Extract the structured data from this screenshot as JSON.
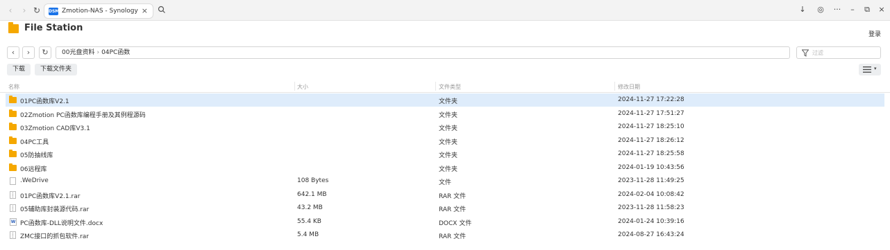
{
  "browser": {
    "tab_title": "Zmotion-NAS - Synology N",
    "favicon_text": "DSM"
  },
  "app": {
    "title": "File Station",
    "login": "登录"
  },
  "path": {
    "parts": [
      "00光盘资料",
      "04PC函数"
    ]
  },
  "filter": {
    "placeholder": "过滤"
  },
  "actions": {
    "download": "下载",
    "download_folder": "下载文件夹"
  },
  "columns": {
    "name": "名称",
    "size": "大小",
    "type": "文件类型",
    "modified": "修改日期"
  },
  "files": [
    {
      "name": "01PC函数库V2.1",
      "size": "",
      "type": "文件夹",
      "modified": "2024-11-27 17:22:28",
      "icon": "folder-icon"
    },
    {
      "name": "02Zmotion PC函数库编程手册及其例程源码",
      "size": "",
      "type": "文件夹",
      "modified": "2024-11-27 17:51:27",
      "icon": "folder-icon"
    },
    {
      "name": "03Zmotion CAD库V3.1",
      "size": "",
      "type": "文件夹",
      "modified": "2024-11-27 18:25:10",
      "icon": "folder-icon"
    },
    {
      "name": "04PC工具",
      "size": "",
      "type": "文件夹",
      "modified": "2024-11-27 18:26:12",
      "icon": "folder-icon"
    },
    {
      "name": "05防抽线库",
      "size": "",
      "type": "文件夹",
      "modified": "2024-11-27 18:25:58",
      "icon": "folder-icon"
    },
    {
      "name": "06远程库",
      "size": "",
      "type": "文件夹",
      "modified": "2024-01-19 10:43:56",
      "icon": "folder-icon"
    },
    {
      "name": ".WeDrive",
      "size": "108 Bytes",
      "type": "文件",
      "modified": "2023-11-28 11:49:25",
      "icon": "file-icon"
    },
    {
      "name": "01PC函数库V2.1.rar",
      "size": "642.1 MB",
      "type": "RAR 文件",
      "modified": "2024-02-04 10:08:42",
      "icon": "archive-icon"
    },
    {
      "name": "05辅助库封装源代码.rar",
      "size": "43.2 MB",
      "type": "RAR 文件",
      "modified": "2023-11-28 11:58:23",
      "icon": "archive-icon"
    },
    {
      "name": "PC函数库-DLL说明文件.docx",
      "size": "55.4 KB",
      "type": "DOCX 文件",
      "modified": "2024-01-24 10:39:16",
      "icon": "word-doc-icon"
    },
    {
      "name": "ZMC接口的抓包软件.rar",
      "size": "5.4 MB",
      "type": "RAR 文件",
      "modified": "2024-08-27 16:43:24",
      "icon": "archive-icon"
    }
  ]
}
